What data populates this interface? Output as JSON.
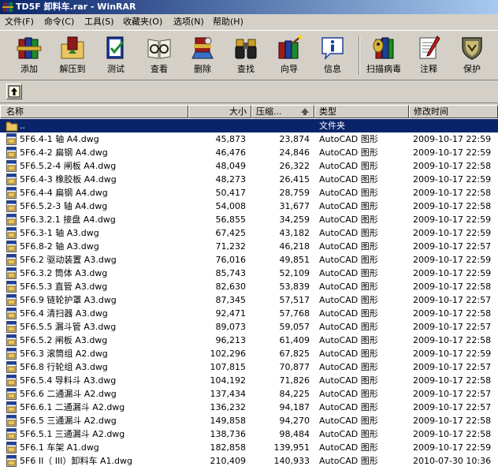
{
  "window": {
    "title": "TD5F 卸料车.rar - WinRAR"
  },
  "menu": [
    {
      "label": "文件(F)"
    },
    {
      "label": "命令(C)"
    },
    {
      "label": "工具(S)"
    },
    {
      "label": "收藏夹(O)"
    },
    {
      "label": "选项(N)"
    },
    {
      "label": "帮助(H)"
    }
  ],
  "toolbar": [
    {
      "label": "添加",
      "icon": "books-add-icon"
    },
    {
      "label": "解压到",
      "icon": "extract-folder-icon"
    },
    {
      "label": "测试",
      "icon": "test-checkmark-icon"
    },
    {
      "label": "查看",
      "icon": "view-glasses-icon"
    },
    {
      "label": "删除",
      "icon": "delete-icon"
    },
    {
      "label": "查找",
      "icon": "binoculars-icon"
    },
    {
      "label": "向导",
      "icon": "wizard-icon"
    },
    {
      "label": "信息",
      "icon": "info-icon"
    },
    {
      "label": "扫描病毒",
      "icon": "virus-scan-icon"
    },
    {
      "label": "注释",
      "icon": "comment-icon"
    },
    {
      "label": "保护",
      "icon": "shield-icon"
    }
  ],
  "columns": [
    {
      "label": "名称"
    },
    {
      "label": "大小"
    },
    {
      "label": "压缩..."
    },
    {
      "label": "类型"
    },
    {
      "label": "修改时间"
    }
  ],
  "parent_row": {
    "name": "..",
    "type": "文件夹"
  },
  "files": [
    {
      "name": "5F6.4-1 轴 A4.dwg",
      "size": "45,873",
      "packed": "23,874",
      "type": "AutoCAD 图形",
      "modified": "2009-10-17 22:59"
    },
    {
      "name": "5F6.4-2 扁钢 A4.dwg",
      "size": "46,476",
      "packed": "24,846",
      "type": "AutoCAD 图形",
      "modified": "2009-10-17 22:59"
    },
    {
      "name": "5F6.5.2-4 闸板 A4.dwg",
      "size": "48,049",
      "packed": "26,322",
      "type": "AutoCAD 图形",
      "modified": "2009-10-17 22:58"
    },
    {
      "name": "5F6.4-3 橡胶板 A4.dwg",
      "size": "48,273",
      "packed": "26,415",
      "type": "AutoCAD 图形",
      "modified": "2009-10-17 22:59"
    },
    {
      "name": "5F6.4-4 扁钢 A4.dwg",
      "size": "50,417",
      "packed": "28,759",
      "type": "AutoCAD 图形",
      "modified": "2009-10-17 22:58"
    },
    {
      "name": "5F6.5.2-3 轴 A4.dwg",
      "size": "54,008",
      "packed": "31,677",
      "type": "AutoCAD 图形",
      "modified": "2009-10-17 22:58"
    },
    {
      "name": "5F6.3.2.1 接盘 A4.dwg",
      "size": "56,855",
      "packed": "34,259",
      "type": "AutoCAD 图形",
      "modified": "2009-10-17 22:59"
    },
    {
      "name": "5F6.3-1 轴 A3.dwg",
      "size": "67,425",
      "packed": "43,182",
      "type": "AutoCAD 图形",
      "modified": "2009-10-17 22:59"
    },
    {
      "name": "5F6.8-2 轴 A3.dwg",
      "size": "71,232",
      "packed": "46,218",
      "type": "AutoCAD 图形",
      "modified": "2009-10-17 22:57"
    },
    {
      "name": "5F6.2 驱动装置 A3.dwg",
      "size": "76,016",
      "packed": "49,851",
      "type": "AutoCAD 图形",
      "modified": "2009-10-17 22:59"
    },
    {
      "name": "5F6.3.2 筒体 A3.dwg",
      "size": "85,743",
      "packed": "52,109",
      "type": "AutoCAD 图形",
      "modified": "2009-10-17 22:59"
    },
    {
      "name": "5F6.5.3 直管 A3.dwg",
      "size": "82,630",
      "packed": "53,839",
      "type": "AutoCAD 图形",
      "modified": "2009-10-17 22:58"
    },
    {
      "name": "5F6.9 链轮护罩 A3.dwg",
      "size": "87,345",
      "packed": "57,517",
      "type": "AutoCAD 图形",
      "modified": "2009-10-17 22:57"
    },
    {
      "name": "5F6.4 清扫器 A3.dwg",
      "size": "92,471",
      "packed": "57,768",
      "type": "AutoCAD 图形",
      "modified": "2009-10-17 22:58"
    },
    {
      "name": "5F6.5.5 漏斗管 A3.dwg",
      "size": "89,073",
      "packed": "59,057",
      "type": "AutoCAD 图形",
      "modified": "2009-10-17 22:57"
    },
    {
      "name": "5F6.5.2 闸板 A3.dwg",
      "size": "96,213",
      "packed": "61,409",
      "type": "AutoCAD 图形",
      "modified": "2009-10-17 22:58"
    },
    {
      "name": "5F6.3 滚筒组 A2.dwg",
      "size": "102,296",
      "packed": "67,825",
      "type": "AutoCAD 图形",
      "modified": "2009-10-17 22:59"
    },
    {
      "name": "5F6.8 行轮组 A3.dwg",
      "size": "107,815",
      "packed": "70,877",
      "type": "AutoCAD 图形",
      "modified": "2009-10-17 22:57"
    },
    {
      "name": "5F6.5.4 导料斗 A3.dwg",
      "size": "104,192",
      "packed": "71,826",
      "type": "AutoCAD 图形",
      "modified": "2009-10-17 22:58"
    },
    {
      "name": "5F6.6 二通漏斗 A2.dwg",
      "size": "137,434",
      "packed": "84,225",
      "type": "AutoCAD 图形",
      "modified": "2009-10-17 22:57"
    },
    {
      "name": "5F6.6.1 二通漏斗 A2.dwg",
      "size": "136,232",
      "packed": "94,187",
      "type": "AutoCAD 图形",
      "modified": "2009-10-17 22:57"
    },
    {
      "name": "5F6.5 三通漏斗 A2.dwg",
      "size": "149,858",
      "packed": "94,270",
      "type": "AutoCAD 图形",
      "modified": "2009-10-17 22:58"
    },
    {
      "name": "5F6.5.1 三通漏斗 A2.dwg",
      "size": "138,736",
      "packed": "98,484",
      "type": "AutoCAD 图形",
      "modified": "2009-10-17 22:58"
    },
    {
      "name": "5F6.1 车架 A1.dwg",
      "size": "182,858",
      "packed": "139,951",
      "type": "AutoCAD 图形",
      "modified": "2009-10-17 22:59"
    },
    {
      "name": "5F6 II（ III）卸料车 A1.dwg",
      "size": "210,409",
      "packed": "140,933",
      "type": "AutoCAD 图形",
      "modified": "2010-07-30 10:36"
    }
  ],
  "colors": {
    "title_start": "#0a246a",
    "title_end": "#a6caf0",
    "selection": "#0a246a",
    "face": "#d4d0c8"
  }
}
